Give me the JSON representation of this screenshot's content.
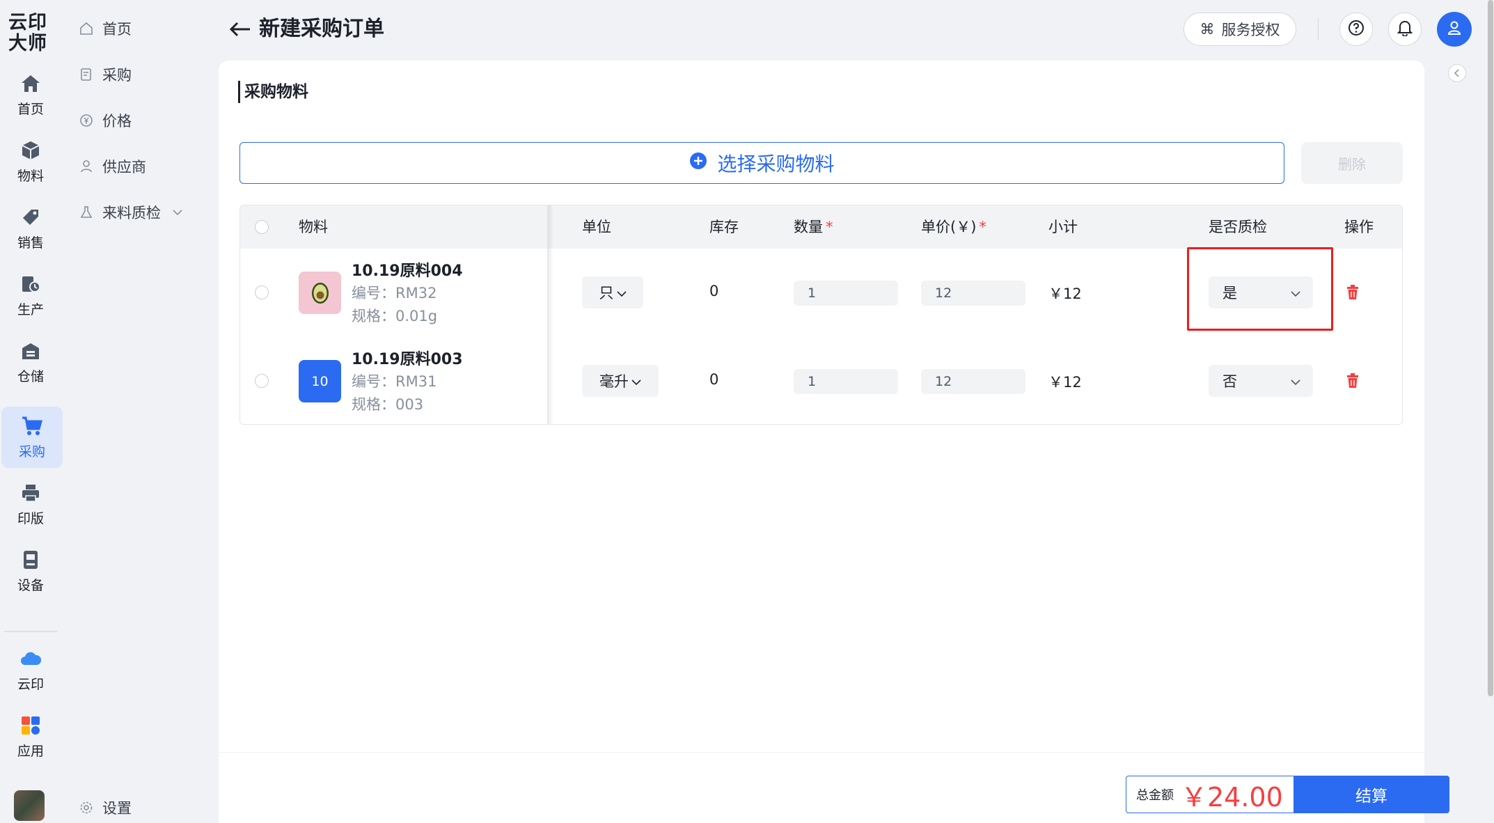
{
  "brand": {
    "logo_line1": "云印",
    "logo_line2": "大师"
  },
  "rail": {
    "items": [
      {
        "label": "首页",
        "icon": "home-icon"
      },
      {
        "label": "物料",
        "icon": "cube-icon"
      },
      {
        "label": "销售",
        "icon": "tag-icon"
      },
      {
        "label": "生产",
        "icon": "production-icon"
      },
      {
        "label": "仓储",
        "icon": "warehouse-icon"
      },
      {
        "label": "采购",
        "icon": "cart-icon",
        "active": true
      },
      {
        "label": "印版",
        "icon": "printer-icon"
      },
      {
        "label": "设备",
        "icon": "device-icon"
      },
      {
        "label": "云印",
        "icon": "cloud-icon"
      },
      {
        "label": "应用",
        "icon": "apps-icon"
      }
    ]
  },
  "subnav": {
    "items": [
      {
        "label": "首页",
        "icon": "home-outline-icon"
      },
      {
        "label": "采购",
        "icon": "document-icon"
      },
      {
        "label": "价格",
        "icon": "yen-icon"
      },
      {
        "label": "供应商",
        "icon": "person-icon"
      },
      {
        "label": "来料质检",
        "icon": "flask-icon"
      }
    ],
    "settings_label": "设置"
  },
  "header": {
    "title": "新建采购订单",
    "service_btn": "服务授权",
    "service_icon": "command-icon"
  },
  "section": {
    "title": "采购物料",
    "select_btn": "选择采购物料",
    "delete_btn": "删除"
  },
  "table": {
    "columns": {
      "material": "物料",
      "unit": "单位",
      "stock": "库存",
      "qty": "数量",
      "price": "单价(￥)",
      "subtotal": "小计",
      "qc": "是否质检",
      "action": "操作"
    },
    "rows": [
      {
        "name": "10.19原料004",
        "code": "编号：RM32",
        "spec": "规格：0.01g",
        "thumb_text": "",
        "thumb_icon": "avocado-icon",
        "unit": "只",
        "stock": "0",
        "qty": "1",
        "price": "12",
        "subtotal": "￥12",
        "qc": "是"
      },
      {
        "name": "10.19原料003",
        "code": "编号：RM31",
        "spec": "规格：003",
        "thumb_text": "10",
        "thumb_icon": "",
        "unit": "毫升",
        "stock": "0",
        "qty": "1",
        "price": "12",
        "subtotal": "￥12",
        "qc": "否"
      }
    ]
  },
  "footer": {
    "total_label": "总金额",
    "total_value": "￥24.00",
    "checkout_btn": "结算"
  },
  "colors": {
    "accent": "#2a6bf2",
    "danger": "#f53f3f",
    "highlight": "#ee1c1c"
  }
}
